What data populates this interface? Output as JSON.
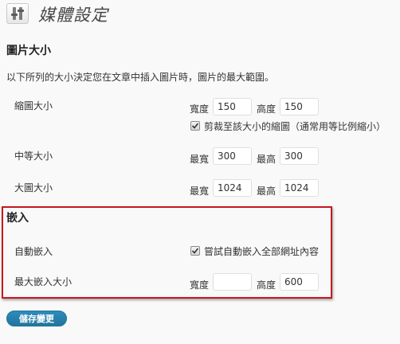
{
  "header": {
    "title": "媒體設定",
    "icon": "media-settings-icon"
  },
  "image_sizes": {
    "section_title": "圖片大小",
    "description": "以下所列的大小決定您在文章中插入圖片時，圖片的最大範圍。",
    "thumbnail": {
      "label": "縮圖大小",
      "width_label": "寬度",
      "width_value": "150",
      "height_label": "高度",
      "height_value": "150",
      "crop_checked": true,
      "crop_label": "剪裁至該大小的縮圖（通常用等比例縮小）"
    },
    "medium": {
      "label": "中等大小",
      "max_width_label": "最寬",
      "max_width_value": "300",
      "max_height_label": "最高",
      "max_height_value": "300"
    },
    "large": {
      "label": "大圖大小",
      "max_width_label": "最寬",
      "max_width_value": "1024",
      "max_height_label": "最高",
      "max_height_value": "1024"
    }
  },
  "embeds": {
    "section_title": "嵌入",
    "auto_embed": {
      "label": "自動嵌入",
      "checked": true,
      "checkbox_label": "嘗試自動嵌入全部網址內容"
    },
    "max_embed": {
      "label": "最大嵌入大小",
      "width_label": "寬度",
      "width_value": "",
      "height_label": "高度",
      "height_value": "600"
    }
  },
  "footer": {
    "save_label": "儲存變更"
  },
  "colors": {
    "highlight_border": "#c5191e",
    "button_bg": "#21759b",
    "page_bg": "#f9f9f9"
  }
}
